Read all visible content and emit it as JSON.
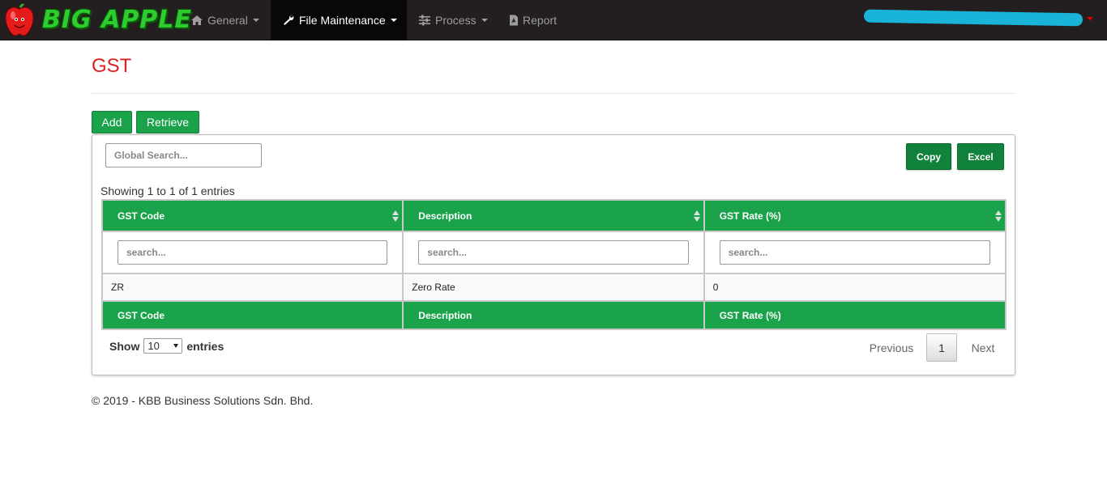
{
  "brand": {
    "name": "BIG APPLE",
    "logo_icon": "apple-icon",
    "colors": {
      "text": "#2ecc2e",
      "apple": "#e41b1b"
    }
  },
  "nav": {
    "items": [
      {
        "label": "General",
        "icon": "home-icon",
        "has_caret": true,
        "active": false
      },
      {
        "label": "File Maintenance",
        "icon": "wrench-icon",
        "has_caret": true,
        "active": true
      },
      {
        "label": "Process",
        "icon": "sliders-icon",
        "has_caret": true,
        "active": false
      },
      {
        "label": "Report",
        "icon": "pdf-file-icon",
        "has_caret": false,
        "active": false
      }
    ]
  },
  "page": {
    "title": "GST"
  },
  "actions": {
    "add_label": "Add",
    "retrieve_label": "Retrieve"
  },
  "toolbar": {
    "global_search_placeholder": "Global Search...",
    "copy_label": "Copy",
    "excel_label": "Excel"
  },
  "table": {
    "info": "Showing 1 to 1 of 1 entries",
    "columns": [
      "GST Code",
      "Description",
      "GST Rate (%)"
    ],
    "column_search_placeholder": "search...",
    "rows": [
      [
        "ZR",
        "Zero Rate",
        "0"
      ]
    ]
  },
  "length": {
    "show_label": "Show",
    "value": "10",
    "entries_label": "entries"
  },
  "pagination": {
    "previous": "Previous",
    "current": "1",
    "next": "Next"
  },
  "footer": {
    "text": "© 2019 - KBB Business Solutions Sdn. Bhd."
  },
  "colors": {
    "accent_green": "#1aa34a",
    "title_red": "#dd1f1f",
    "navbar": "#231f20"
  }
}
